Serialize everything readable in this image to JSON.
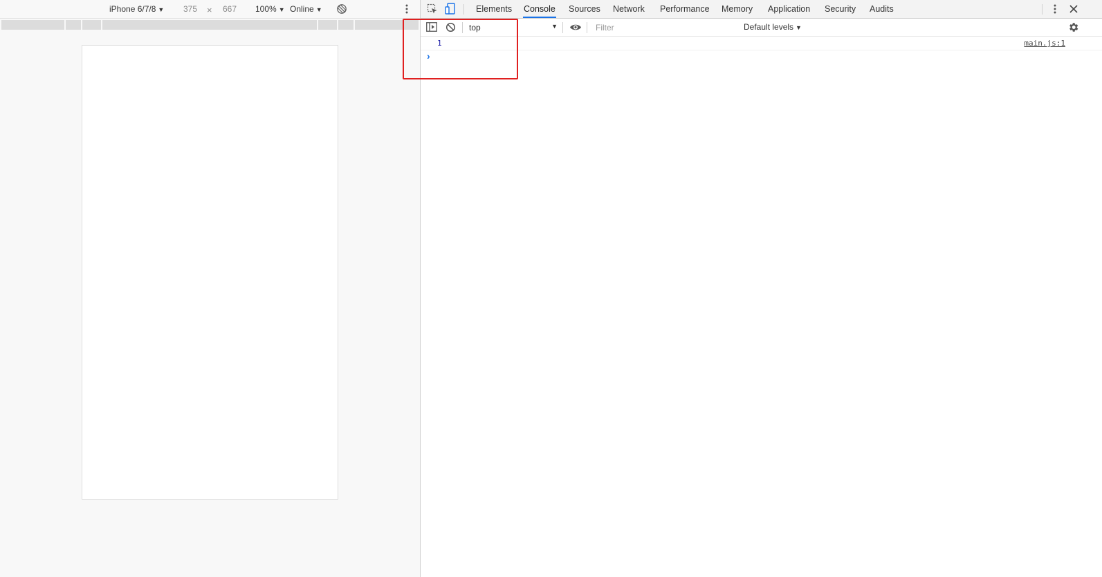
{
  "device_toolbar": {
    "device_name": "iPhone 6/7/8",
    "width_value": "375",
    "times_sign": "×",
    "height_value": "667",
    "zoom": "100%",
    "throttling": "Online"
  },
  "devtools": {
    "tabs": [
      {
        "label": "Elements"
      },
      {
        "label": "Console"
      },
      {
        "label": "Sources"
      },
      {
        "label": "Network"
      },
      {
        "label": "Performance"
      },
      {
        "label": "Memory"
      },
      {
        "label": "Application"
      },
      {
        "label": "Security"
      },
      {
        "label": "Audits"
      }
    ],
    "active_tab": "Console",
    "accent_color": "#1a73e8"
  },
  "console": {
    "context": "top",
    "filter_placeholder": "Filter",
    "levels": "Default levels",
    "messages": [
      {
        "value": "1",
        "source": "main.js:1"
      }
    ],
    "prompt_symbol": "›"
  },
  "annotation": {
    "color": "#e02020"
  }
}
